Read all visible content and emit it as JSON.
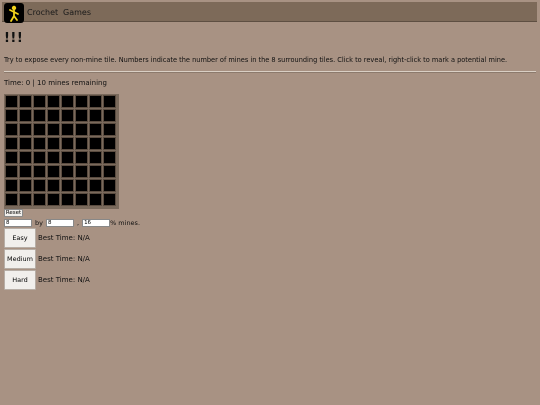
{
  "nav": {
    "logo_icon": "figure-logo-icon",
    "links": [
      "Crochet",
      "Games"
    ]
  },
  "page_title": "!!!",
  "instructions": "Try to expose every non-mine tile. Numbers indicate the number of mines in the 8 surrounding tiles. Click to reveal, right-click to mark a potential mine.",
  "status": {
    "time_label": "Time:",
    "time": "0",
    "separator": "|",
    "mines_remaining": "10",
    "mines_label": "mines remaining"
  },
  "board": {
    "rows": 8,
    "cols": 8
  },
  "controls": {
    "reset_label": "Reset",
    "width": "8",
    "by_label": "by",
    "height": "8",
    "comma": ",",
    "mine_percent": "16",
    "percent_label": "% mines."
  },
  "levels": [
    {
      "label": "Easy",
      "best_time_label": "Best Time: N/A"
    },
    {
      "label": "Medium",
      "best_time_label": "Best Time: N/A"
    },
    {
      "label": "Hard",
      "best_time_label": "Best Time: N/A"
    }
  ],
  "colors": {
    "background": "#a89283",
    "navbar": "#7d6a59",
    "tile": "#000000",
    "logo_figure": "#f2d31b"
  }
}
